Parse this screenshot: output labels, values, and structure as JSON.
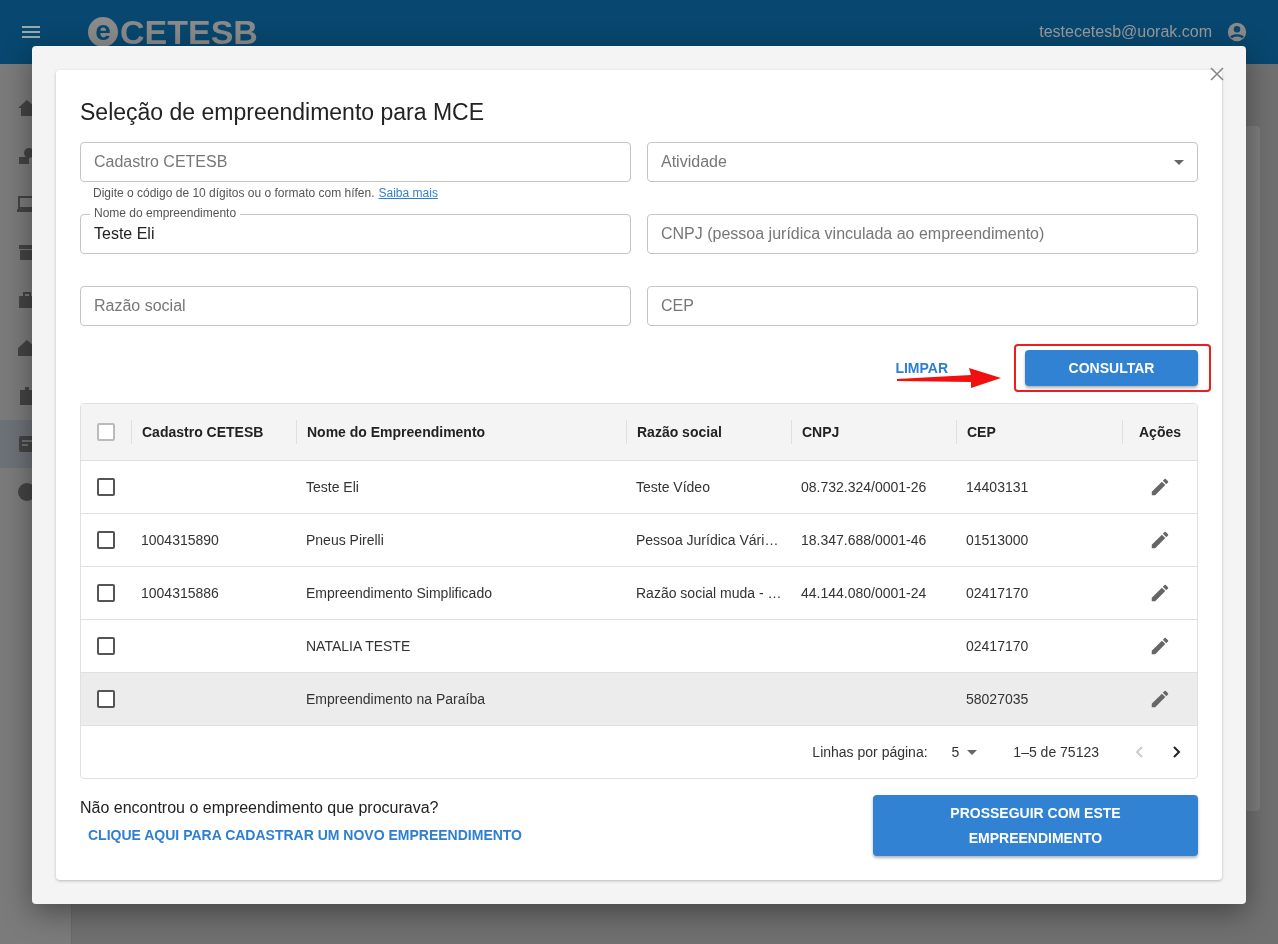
{
  "header": {
    "logo_mark": "e",
    "logo_text": "CETESB",
    "user_email": "testecetesb@uorak.com"
  },
  "sidebar": {
    "items": [
      {
        "selected": false
      },
      {
        "selected": false
      },
      {
        "selected": false
      },
      {
        "selected": false
      },
      {
        "selected": false
      },
      {
        "selected": false
      },
      {
        "selected": false
      },
      {
        "selected": true
      },
      {
        "selected": false
      }
    ]
  },
  "dialog": {
    "title": "Seleção de empreendimento para MCE",
    "fields": [
      {
        "kind": "text",
        "placeholder": "Cadastro CETESB",
        "helper": "Digite o código de 10 dígitos ou o formato com hífen.",
        "helper_link": "Saiba mais"
      },
      {
        "kind": "select",
        "placeholder": "Atividade"
      },
      {
        "kind": "text",
        "label": "Nome do empreendimento",
        "value": "Teste Eli"
      },
      {
        "kind": "text",
        "placeholder": "CNPJ (pessoa jurídica vinculada ao empreendimento)"
      },
      {
        "kind": "text",
        "placeholder": "Razão social"
      },
      {
        "kind": "text",
        "placeholder": "CEP"
      }
    ],
    "clear_button": "LIMPAR",
    "search_button": {
      "label": "CONSULTAR",
      "annotated": true
    },
    "table": {
      "select_all": {
        "checked": false
      },
      "columns": [
        "Cadastro CETESB",
        "Nome do Empreendimento",
        "Razão social",
        "CNPJ",
        "CEP",
        "Ações"
      ],
      "rows": [
        {
          "checked": false,
          "hovered": false,
          "cells": [
            "",
            "Teste Eli",
            "Teste Vídeo",
            "08.732.324/0001-26",
            "14403131"
          ]
        },
        {
          "checked": false,
          "hovered": false,
          "cells": [
            "1004315890",
            "Pneus Pirelli",
            "Pessoa Jurídica Vári…",
            "18.347.688/0001-46",
            "01513000"
          ]
        },
        {
          "checked": false,
          "hovered": false,
          "cells": [
            "1004315886",
            "Empreendimento Simplificado",
            "Razão social muda - …",
            "44.144.080/0001-24",
            "02417170"
          ]
        },
        {
          "checked": false,
          "hovered": false,
          "cells": [
            "",
            "NATALIA TESTE",
            "",
            "",
            "02417170"
          ]
        },
        {
          "checked": false,
          "hovered": true,
          "cells": [
            "",
            "Empreendimento na Paraíba",
            "",
            "",
            "58027035"
          ]
        }
      ],
      "pagination": {
        "rows_per_page_label": "Linhas por página:",
        "rows_per_page": "5",
        "range": "1–5 de 75123",
        "prev_disabled": true,
        "next_disabled": false
      }
    },
    "not_found_text": "Não encontrou o empreendimento que procurava?",
    "register_link": "CLIQUE AQUI PARA CADASTRAR UM NOVO EMPREENDIMENTO",
    "proceed_button": "PROSSEGUIR COM ESTE EMPREENDIMENTO"
  }
}
